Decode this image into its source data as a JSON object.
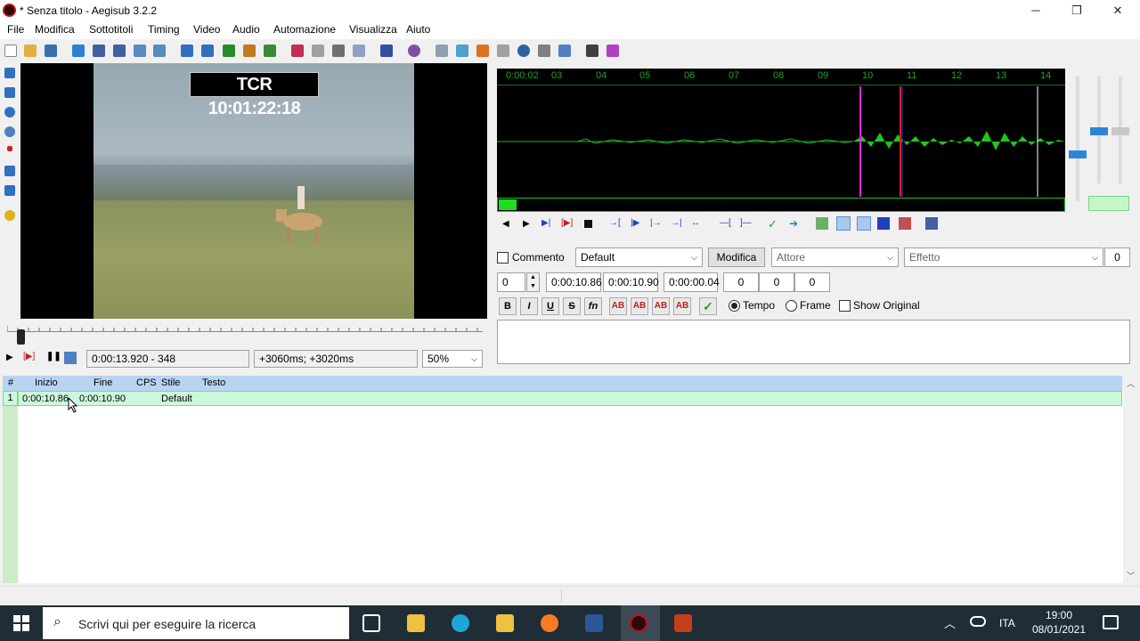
{
  "window": {
    "title": "* Senza titolo - Aegisub 3.2.2",
    "controls": [
      "─",
      "❐",
      "✕"
    ]
  },
  "menu": [
    "File",
    "Modifica",
    "Sottotitoli",
    "Timing",
    "Video",
    "Audio",
    "Automazione",
    "Visualizza",
    "Aiuto"
  ],
  "video": {
    "overlay_text": "TCR 10:01:22:18",
    "position": "0:00:13.920 - 348",
    "offset": "+3060ms; +3020ms",
    "zoom": "50%"
  },
  "audio": {
    "ruler_labels": [
      "0:00:02",
      "03",
      "04",
      "05",
      "06",
      "07",
      "08",
      "09",
      "10",
      "11",
      "12",
      "13",
      "14"
    ]
  },
  "edit": {
    "comment_label": "Commento",
    "style": "Default",
    "modify_btn": "Modifica",
    "actor_placeholder": "Attore",
    "effect_placeholder": "Effetto",
    "layer_right": "0",
    "layer": "0",
    "start": "0:00:10.86",
    "end": "0:00:10.90",
    "duration": "0:00:00.04",
    "margin_l": "0",
    "margin_r": "0",
    "margin_v": "0",
    "bold": "B",
    "italic": "I",
    "underline": "U",
    "strike": "S",
    "fn": "fn",
    "color1": "AB",
    "color2": "AB",
    "color3": "AB",
    "color4": "AB",
    "time_radio": "Tempo",
    "frame_radio": "Frame",
    "show_original": "Show Original"
  },
  "grid": {
    "headers": [
      "#",
      "Inizio",
      "Fine",
      "CPS",
      "Stile",
      "Testo"
    ],
    "rows": [
      {
        "num": "1",
        "start": "0:00:10.86",
        "end": "0:00:10.90",
        "cps": "",
        "style": "Default",
        "text": ""
      }
    ]
  },
  "taskbar": {
    "search_placeholder": "Scrivi qui per eseguire la ricerca",
    "lang": "ITA",
    "time": "19:00",
    "date": "08/01/2021"
  }
}
